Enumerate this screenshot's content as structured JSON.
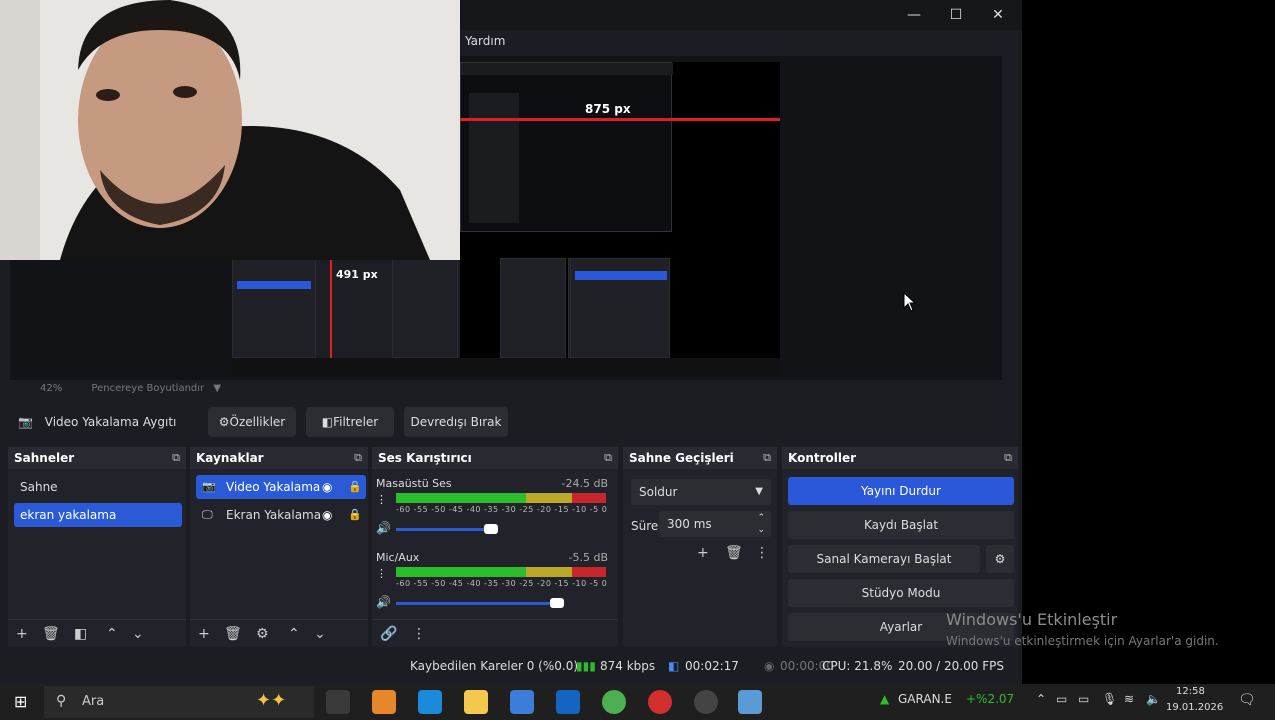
{
  "window": {
    "menu": "Yardım"
  },
  "preview": {
    "nested_label": "875 px",
    "nested_left_label": "491 px",
    "zoom_label": "42%",
    "scale_mode": "Pencereye Boyutlandır"
  },
  "source_toolbar": {
    "source_name": "Video Yakalama Aygıtı",
    "properties": "Özellikler",
    "filters": "Filtreler",
    "deactivate": "Devredışı Bırak"
  },
  "scenes": {
    "title": "Sahneler",
    "items": [
      {
        "label": "Sahne"
      },
      {
        "label": "ekran yakalama"
      }
    ]
  },
  "sources": {
    "title": "Kaynaklar",
    "items": [
      {
        "label": "Video Yakalama"
      },
      {
        "label": "Ekran Yakalama"
      }
    ]
  },
  "mixer": {
    "title": "Ses Karıştırıcı",
    "channels": [
      {
        "name": "Masaüstü Ses",
        "db": "-24.5 dB",
        "level": 0.37
      },
      {
        "name": "Mic/Aux",
        "db": "-5.5 dB",
        "level": 0.8
      }
    ],
    "scale": "-60 -55 -50 -45 -40 -35 -30 -25 -20 -15 -10 -5 0"
  },
  "transitions": {
    "title": "Sahne Geçişleri",
    "selected": "Soldur",
    "duration_label": "Süre",
    "duration": "300 ms"
  },
  "controls": {
    "title": "Kontroller",
    "stop_stream": "Yayını Durdur",
    "start_record": "Kaydı Başlat",
    "virtual_cam": "Sanal Kamerayı Başlat",
    "studio_mode": "Stüdyo Modu",
    "settings": "Ayarlar"
  },
  "status": {
    "dropped": "Kaybedilen Kareler 0 (%0.0)",
    "bitrate": "874 kbps",
    "stream_time": "00:02:17",
    "record_time": "00:00:00",
    "cpu": "CPU: 21.8%",
    "fps": "20.00 / 20.00 FPS"
  },
  "watermark": {
    "title": "Windows'u Etkinleştir",
    "sub": "Windows'u etkinleştirmek için Ayarlar'a gidin."
  },
  "taskbar": {
    "search": "Ara",
    "stock_name": "GARAN.E",
    "stock_change": "+%2.07",
    "time": "12:58",
    "date": "19.01.2026"
  }
}
